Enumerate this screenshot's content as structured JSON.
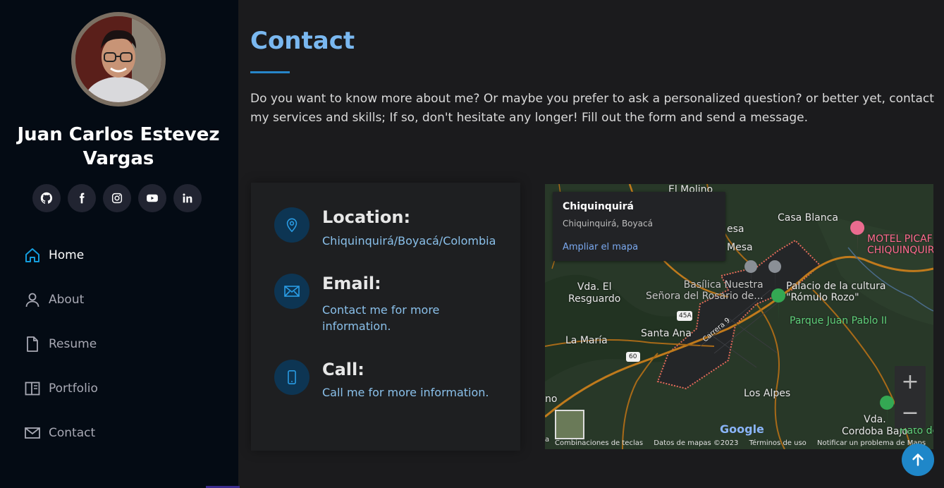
{
  "profile": {
    "name": "Juan Carlos Estevez Vargas",
    "socials": [
      "github-icon",
      "facebook-icon",
      "instagram-icon",
      "youtube-icon",
      "linkedin-icon"
    ]
  },
  "nav": {
    "items": [
      {
        "label": "Home",
        "icon": "home-icon",
        "active": true
      },
      {
        "label": "About",
        "icon": "person-icon",
        "active": false
      },
      {
        "label": "Resume",
        "icon": "file-icon",
        "active": false
      },
      {
        "label": "Portfolio",
        "icon": "portfolio-icon",
        "active": false
      },
      {
        "label": "Contact",
        "icon": "envelope-icon",
        "active": false
      }
    ]
  },
  "contact": {
    "title": "Contact",
    "intro": "Do you want to know more about me? Or maybe you prefer to ask a personalized question? or better yet, contact my services and skills; If so, don't hesitate any longer! Fill out the form and send a message.",
    "location": {
      "label": "Location:",
      "value": "Chiquinquirá/Boyacá/Colombia"
    },
    "email": {
      "label": "Email:",
      "value": "Contact me for more information."
    },
    "call": {
      "label": "Call:",
      "value": "Call me for more information."
    }
  },
  "map": {
    "popup": {
      "title": "Chiquinquirá",
      "subtitle": "Chiquinquirá, Boyacá",
      "link": "Ampliar el mapa"
    },
    "places": {
      "el_molino": "El Molino",
      "casa_blanca": "Casa Blanca",
      "esa": "esa",
      "mesa": "Mesa",
      "motel": "MOTEL PICAF\nCHIQUINQUIR",
      "vda_el_resguardo": "Vda. El\nResguardo",
      "basilica": "Basílica Nuestra\nSeñora del Rosario de...",
      "palacio": "Palacio de la cultura\n\"Rómulo Rozo\"",
      "parque": "Parque Juan Pablo II",
      "santa_ana": "Santa Ana",
      "la_maria": "La María",
      "carrera": "Carrera 9",
      "road_45a": "45A",
      "road_60": "60",
      "los_alpes": "Los Alpes",
      "cordoba": "Vda.\nCordoba Bajo",
      "hato": "Hato de",
      "no": "no",
      "la": "a"
    },
    "google": "Google",
    "footer": [
      "Combinaciones de teclas",
      "Datos de mapas ©2023",
      "Términos de uso",
      "Notificar un problema de Maps"
    ],
    "colors": {
      "road": "#c07a1c",
      "boundary": "#e46a5b",
      "terrain": "#2a3a2a"
    }
  }
}
